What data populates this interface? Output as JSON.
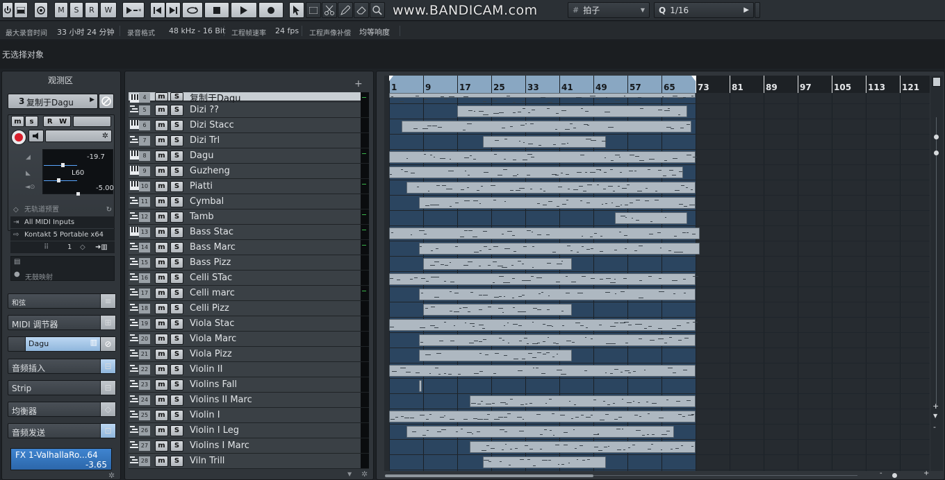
{
  "toolbar": {
    "msrw": [
      "M",
      "S",
      "R",
      "W"
    ],
    "watermark": "www.BANDICAM.com",
    "grid_type": "拍子",
    "quantize": "1/16",
    "quantize_q": "Q"
  },
  "info_line": {
    "max_rec_label": "最大录音时间",
    "max_rec_value": "33 小时 24 分钟",
    "rec_format_label": "录音格式",
    "rec_format_value": "48 kHz - 16 Bit",
    "frame_rate_label": "工程帧速率",
    "frame_rate_value": "24 fps",
    "pan_law_label": "工程声像补偿",
    "pan_law_value": "均等响度"
  },
  "selection_line": {
    "text": "无选择对象"
  },
  "inspector": {
    "title": "观测区",
    "track_number": "3",
    "track_name": "复制于Dagu",
    "buttons": [
      "m",
      "s",
      "R",
      "W"
    ],
    "volume_value": "-19.7",
    "pan_value": "L60",
    "delay_value": "-5.00",
    "track_preset": "无轨道预置",
    "midi_input": "All MIDI Inputs",
    "midi_output": "Kontakt 5 Portable x64",
    "channel": "1",
    "no_map": "无鼓映射",
    "sections": {
      "chord": "和弦",
      "midi_modifiers": "MIDI 调节器",
      "instrument": "Dagu",
      "audio_inserts": "音频插入",
      "strip": "Strip",
      "eq": "均衡器",
      "audio_sends": "音频发送"
    },
    "fx_name": "FX 1-ValhallaRo...64",
    "fx_value": "-3.65"
  },
  "tracks": [
    {
      "num": "4",
      "name": "复制于Dagu",
      "type": "instrument",
      "selected": true
    },
    {
      "num": "5",
      "name": "Dizi ??",
      "type": "midi"
    },
    {
      "num": "6",
      "name": "Dizi Stacc",
      "type": "instrument"
    },
    {
      "num": "7",
      "name": "Dizi Trl",
      "type": "midi"
    },
    {
      "num": "8",
      "name": "Dagu",
      "type": "instrument"
    },
    {
      "num": "9",
      "name": "Guzheng",
      "type": "instrument"
    },
    {
      "num": "10",
      "name": "Piatti",
      "type": "instrument"
    },
    {
      "num": "11",
      "name": "Cymbal",
      "type": "midi"
    },
    {
      "num": "12",
      "name": "Tamb",
      "type": "midi"
    },
    {
      "num": "13",
      "name": "Bass Stac",
      "type": "instrument"
    },
    {
      "num": "14",
      "name": "Bass Marc",
      "type": "midi"
    },
    {
      "num": "15",
      "name": "Bass Pizz",
      "type": "midi"
    },
    {
      "num": "16",
      "name": "Celli STac",
      "type": "midi"
    },
    {
      "num": "17",
      "name": "Celli marc",
      "type": "midi"
    },
    {
      "num": "18",
      "name": "Celli Pizz",
      "type": "midi"
    },
    {
      "num": "19",
      "name": "Viola Stac",
      "type": "midi"
    },
    {
      "num": "20",
      "name": "Viola Marc",
      "type": "midi"
    },
    {
      "num": "21",
      "name": "Viola Pizz",
      "type": "midi"
    },
    {
      "num": "22",
      "name": "Violin II",
      "type": "midi"
    },
    {
      "num": "23",
      "name": "Violins Fall",
      "type": "midi"
    },
    {
      "num": "24",
      "name": "Violins II Marc",
      "type": "midi"
    },
    {
      "num": "25",
      "name": "Violin I",
      "type": "midi"
    },
    {
      "num": "26",
      "name": "Violin I Leg",
      "type": "midi"
    },
    {
      "num": "27",
      "name": "Violins I Marc",
      "type": "midi"
    },
    {
      "num": "28",
      "name": "Viln Trill",
      "type": "midi"
    }
  ],
  "ruler": {
    "bars": [
      "1",
      "9",
      "17",
      "25",
      "33",
      "41",
      "49",
      "57",
      "65",
      "73",
      "81",
      "89",
      "97",
      "105",
      "113",
      "121"
    ],
    "cycle_end_bar": 73
  },
  "parts": [
    {
      "lane": 0,
      "from": 1,
      "to": 73
    },
    {
      "lane": 1,
      "from": 17,
      "to": 71
    },
    {
      "lane": 2,
      "from": 4,
      "to": 72
    },
    {
      "lane": 3,
      "from": 23,
      "to": 52
    },
    {
      "lane": 4,
      "from": 1,
      "to": 73
    },
    {
      "lane": 5,
      "from": 1,
      "to": 70
    },
    {
      "lane": 6,
      "from": 5,
      "to": 73
    },
    {
      "lane": 7,
      "from": 8,
      "to": 73
    },
    {
      "lane": 8,
      "from": 54,
      "to": 71
    },
    {
      "lane": 9,
      "from": 1,
      "to": 74
    },
    {
      "lane": 10,
      "from": 8,
      "to": 74
    },
    {
      "lane": 11,
      "from": 9,
      "to": 44
    },
    {
      "lane": 12,
      "from": 1,
      "to": 73
    },
    {
      "lane": 13,
      "from": 8,
      "to": 73
    },
    {
      "lane": 14,
      "from": 9,
      "to": 44
    },
    {
      "lane": 15,
      "from": 1,
      "to": 73
    },
    {
      "lane": 16,
      "from": 8,
      "to": 73
    },
    {
      "lane": 17,
      "from": 8,
      "to": 44
    },
    {
      "lane": 18,
      "from": 1,
      "to": 73
    },
    {
      "lane": 19,
      "from": 8,
      "to": 8.6
    },
    {
      "lane": 20,
      "from": 20,
      "to": 73
    },
    {
      "lane": 21,
      "from": 1,
      "to": 73
    },
    {
      "lane": 22,
      "from": 5,
      "to": 68
    },
    {
      "lane": 23,
      "from": 20,
      "to": 73
    },
    {
      "lane": 24,
      "from": 23,
      "to": 52
    }
  ]
}
